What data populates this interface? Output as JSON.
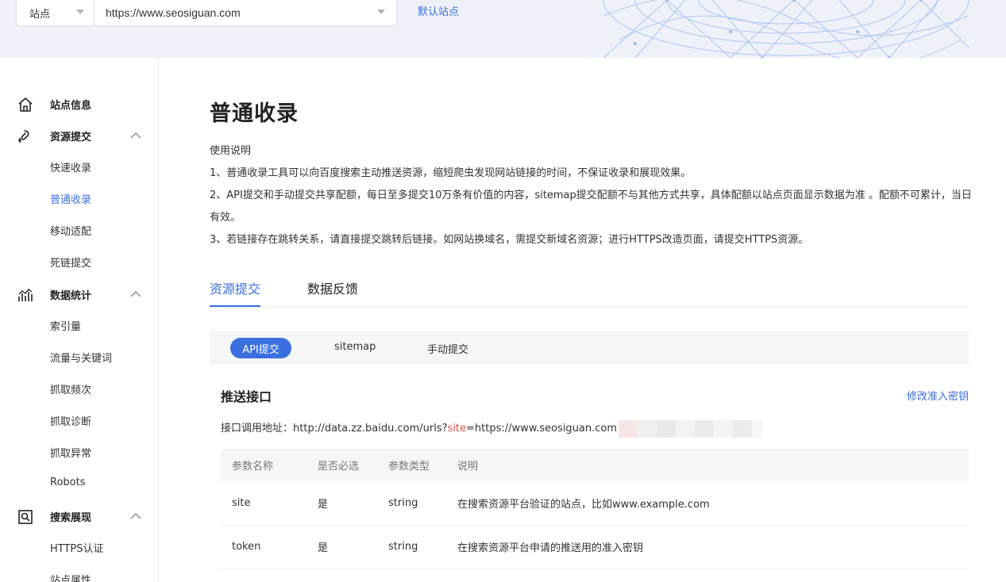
{
  "header": {
    "site_select_label": "站点",
    "site_url": "https://www.seosiguan.com",
    "default_site_link": "默认站点"
  },
  "sidebar": {
    "groups": [
      {
        "label": "站点信息",
        "icon": "home-icon",
        "items": []
      },
      {
        "label": "资源提交",
        "icon": "submit-icon",
        "expanded": true,
        "items": [
          "快速收录",
          "普通收录",
          "移动适配",
          "死链提交"
        ]
      },
      {
        "label": "数据统计",
        "icon": "stats-icon",
        "expanded": true,
        "items": [
          "索引量",
          "流量与关键词",
          "抓取频次",
          "抓取诊断",
          "抓取异常",
          "Robots"
        ]
      },
      {
        "label": "搜索展现",
        "icon": "search-display-icon",
        "expanded": true,
        "items": [
          "HTTPS认证",
          "站点属性"
        ]
      }
    ],
    "active_item": "普通收录"
  },
  "main": {
    "title": "普通收录",
    "usage_title": "使用说明",
    "usage_lines": [
      "1、普通收录工具可以向百度搜索主动推送资源，缩短爬虫发现网站链接的时间，不保证收录和展现效果。",
      "2、API提交和手动提交共享配额，每日至多提交10万条有价值的内容，sitemap提交配额不与其他方式共享，具体配额以站点页面显示数据为准 。配额不可累计，当日有效。",
      "3、若链接存在跳转关系，请直接提交跳转后链接。如网站换域名，需提交新域名资源；进行HTTPS改造页面，请提交HTTPS资源。"
    ],
    "tabs": [
      {
        "label": "资源提交",
        "active": true
      },
      {
        "label": "数据反馈",
        "active": false
      }
    ],
    "subtabs": [
      {
        "label": "API提交",
        "active": true
      },
      {
        "label": "sitemap",
        "active": false
      },
      {
        "label": "手动提交",
        "active": false
      }
    ],
    "section_title": "推送接口",
    "modify_key_link": "修改准入密钥",
    "api_label": "接口调用地址：",
    "api_url_prefix": "http://data.zz.baidu.com/urls?",
    "api_url_param": "site",
    "api_url_suffix": "=https://www.seosiguan.com",
    "table": {
      "headers": [
        "参数名称",
        "是否必选",
        "参数类型",
        "说明"
      ],
      "rows": [
        [
          "site",
          "是",
          "string",
          "在搜索资源平台验证的站点，比如www.example.com"
        ],
        [
          "token",
          "是",
          "string",
          "在搜索资源平台申请的推送用的准入密钥"
        ]
      ]
    }
  },
  "colors": {
    "accent": "#3b6fe0",
    "header_bg": "#eef1f8",
    "param_red": "#e34d4d"
  }
}
